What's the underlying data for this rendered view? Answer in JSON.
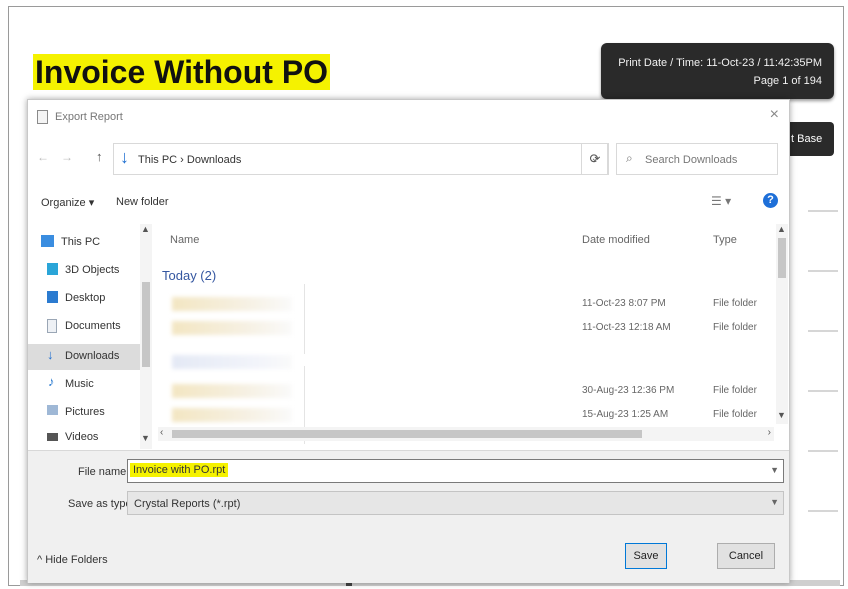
{
  "report": {
    "title": "Invoice Without PO",
    "print_date": "Print Date / Time: 11-Oct-23 / 11:42:35PM",
    "page": "Page 1 of 194",
    "side_tab": "t Base"
  },
  "dialog": {
    "title": "Export Report",
    "close": "×",
    "nav": {
      "back": "←",
      "forward": "→",
      "up": "↑"
    },
    "address": {
      "path": "This PC  ›  Downloads",
      "dropdown": "⌄",
      "refresh": "⟳"
    },
    "search": {
      "placeholder": "Search Downloads",
      "icon": "⌕"
    },
    "toolbar": {
      "organize": "Organize ▾",
      "new_folder": "New folder",
      "view": "☰ ▾",
      "help": "?"
    },
    "tree": [
      {
        "label": "This PC",
        "icon": "computer-icon",
        "color": "#3a8de0"
      },
      {
        "label": "3D Objects",
        "icon": "cube-icon",
        "color": "#2aa5d8"
      },
      {
        "label": "Desktop",
        "icon": "desktop-icon",
        "color": "#2b7bd0"
      },
      {
        "label": "Documents",
        "icon": "document-icon",
        "color": "#9aa6b5"
      },
      {
        "label": "Downloads",
        "icon": "download-icon",
        "color": "#1f6fd1",
        "selected": true
      },
      {
        "label": "Music",
        "icon": "music-icon",
        "color": "#2b7bd0"
      },
      {
        "label": "Pictures",
        "icon": "pictures-icon",
        "color": "#6c8fb6"
      },
      {
        "label": "Videos",
        "icon": "video-icon",
        "color": "#555555"
      }
    ],
    "columns": {
      "name": "Name",
      "date": "Date modified",
      "type": "Type"
    },
    "group": "Today (2)",
    "files": [
      {
        "date": "11-Oct-23 8:07 PM",
        "type": "File folder"
      },
      {
        "date": "11-Oct-23 12:18 AM",
        "type": "File folder"
      },
      {
        "date": "30-Aug-23 12:36 PM",
        "type": "File folder"
      },
      {
        "date": "15-Aug-23 1:25 AM",
        "type": "File folder"
      }
    ],
    "file_name": {
      "label": "File name:",
      "value": "Invoice with PO.rpt"
    },
    "save_type": {
      "label": "Save as type:",
      "value": "Crystal Reports (*.rpt)"
    },
    "hide_folders": "Hide Folders",
    "save_button": "Save",
    "cancel_button": "Cancel"
  },
  "colors": {
    "highlight": "#f5f200",
    "accent": "#0078d7",
    "dark_panel": "#2a2a2a"
  }
}
